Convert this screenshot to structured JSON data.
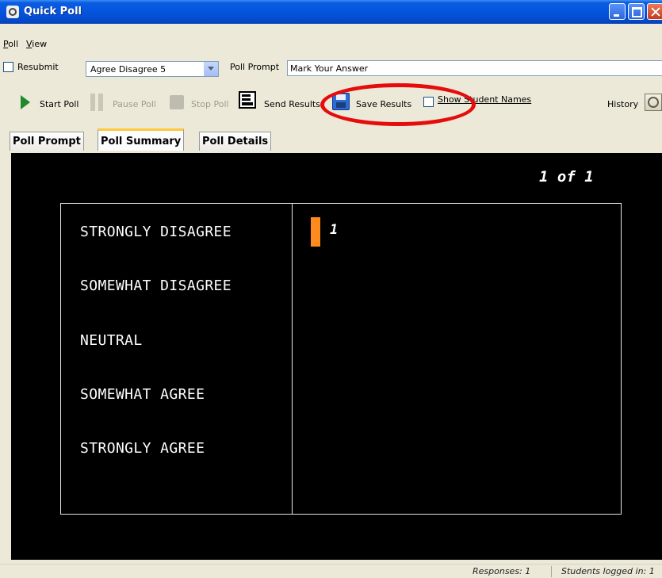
{
  "window": {
    "title": "Quick Poll"
  },
  "menu": {
    "items": [
      "Poll",
      "View"
    ]
  },
  "settings": {
    "resubmit_label": "Resubmit",
    "resubmit_checked": false,
    "poll_type_selected": "Agree Disagree 5",
    "poll_prompt_label": "Poll Prompt",
    "poll_prompt_value": "Mark Your Answer"
  },
  "toolbar": {
    "start_label": "Start Poll",
    "pause_label": "Pause Poll",
    "stop_label": "Stop Poll",
    "send_label": "Send Results",
    "save_label": "Save Results",
    "show_names_label": "Show Student Names",
    "show_names_checked": false,
    "history_label": "History"
  },
  "tabs": [
    "Poll Prompt",
    "Poll Summary",
    "Poll Details"
  ],
  "active_tab": "Poll Summary",
  "summary": {
    "page": "1 of 1",
    "answers": [
      {
        "label": "STRONGLY DISAGREE",
        "count": "1"
      },
      {
        "label": "SOMEWHAT DISAGREE",
        "count": ""
      },
      {
        "label": "NEUTRAL",
        "count": ""
      },
      {
        "label": "SOMEWHAT AGREE",
        "count": ""
      },
      {
        "label": "STRONGLY AGREE",
        "count": ""
      }
    ]
  },
  "status": {
    "responses": "Responses: 1",
    "students": "Students logged in: 1"
  },
  "colors": {
    "bar": "#ff8a1e",
    "annotation": "#e60c0c",
    "active_tab_accent": "#ffc83c"
  }
}
